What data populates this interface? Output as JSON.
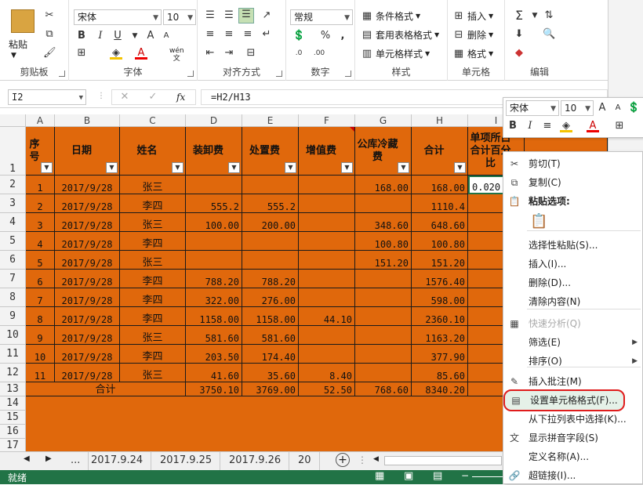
{
  "ribbon": {
    "clipboard": {
      "paste": "粘贴",
      "label": "剪贴板"
    },
    "font": {
      "name": "宋体",
      "size": "10",
      "label": "字体",
      "bold": "B",
      "italic": "I",
      "underline": "U",
      "phonetic": "wén"
    },
    "alignment": {
      "label": "对齐方式"
    },
    "number": {
      "format": "常规",
      "label": "数字",
      "percent": "%",
      "comma": ","
    },
    "styles": {
      "conditional": "条件格式",
      "table": "套用表格格式",
      "cell": "单元格样式",
      "label": "样式"
    },
    "cells": {
      "insert": "插入",
      "delete": "删除",
      "format": "格式",
      "label": "单元格"
    },
    "editing": {
      "label": "编辑"
    }
  },
  "formula_bar": {
    "name_box": "I2",
    "fx": "fx",
    "formula": "=H2/H13"
  },
  "columns": [
    "A",
    "B",
    "C",
    "D",
    "E",
    "F",
    "G",
    "H",
    "I"
  ],
  "headers": [
    "序号",
    "日期",
    "姓名",
    "装卸费",
    "处置费",
    "增值费",
    "公库冷藏费",
    "合计",
    "单项所占合计百分比"
  ],
  "row_numbers": [
    "1",
    "2",
    "3",
    "4",
    "5",
    "6",
    "7",
    "8",
    "9",
    "10",
    "11",
    "12",
    "13",
    "14",
    "15",
    "16",
    "17"
  ],
  "rows": [
    [
      "1",
      "2017/9/28",
      "张三",
      "",
      "",
      "",
      "168.00",
      "168.00",
      "0.020"
    ],
    [
      "2",
      "2017/9/28",
      "李四",
      "555.2",
      "555.2",
      "",
      "",
      "1110.4",
      ""
    ],
    [
      "3",
      "2017/9/28",
      "张三",
      "100.00",
      "200.00",
      "",
      "348.60",
      "648.60",
      ""
    ],
    [
      "4",
      "2017/9/28",
      "李四",
      "",
      "",
      "",
      "100.80",
      "100.80",
      ""
    ],
    [
      "5",
      "2017/9/28",
      "张三",
      "",
      "",
      "",
      "151.20",
      "151.20",
      ""
    ],
    [
      "6",
      "2017/9/28",
      "李四",
      "788.20",
      "788.20",
      "",
      "",
      "1576.40",
      ""
    ],
    [
      "7",
      "2017/9/28",
      "李四",
      "322.00",
      "276.00",
      "",
      "",
      "598.00",
      ""
    ],
    [
      "8",
      "2017/9/28",
      "李四",
      "1158.00",
      "1158.00",
      "44.10",
      "",
      "2360.10",
      ""
    ],
    [
      "9",
      "2017/9/28",
      "张三",
      "581.60",
      "581.60",
      "",
      "",
      "1163.20",
      ""
    ],
    [
      "10",
      "2017/9/28",
      "李四",
      "203.50",
      "174.40",
      "",
      "",
      "377.90",
      ""
    ],
    [
      "11",
      "2017/9/28",
      "张三",
      "41.60",
      "35.60",
      "8.40",
      "",
      "85.60",
      ""
    ]
  ],
  "total_row": {
    "label": "合计",
    "values": [
      "3750.10",
      "3769.00",
      "52.50",
      "768.60",
      "8340.20"
    ]
  },
  "tabs": {
    "ellipsis": "...",
    "sheets": [
      "2017.9.24",
      "2017.9.25",
      "2017.9.26",
      "20"
    ]
  },
  "status": {
    "text": "就绪"
  },
  "mini_toolbar": {
    "font": "宋体",
    "size": "10"
  },
  "context_menu": [
    {
      "label": "剪切(T)",
      "icon": "scissors-icon"
    },
    {
      "label": "复制(C)",
      "icon": "copy-icon"
    },
    {
      "label": "粘贴选项:",
      "icon": "paste-icon"
    },
    {
      "label": "",
      "icon": "paste-clipboard-icon"
    },
    {
      "label": "选择性粘贴(S)...",
      "icon": ""
    },
    {
      "label": "插入(I)...",
      "icon": ""
    },
    {
      "label": "删除(D)...",
      "icon": ""
    },
    {
      "label": "清除内容(N)",
      "icon": ""
    },
    {
      "label": "快速分析(Q)",
      "icon": "quick-analysis-icon"
    },
    {
      "label": "筛选(E)",
      "icon": ""
    },
    {
      "label": "排序(O)",
      "icon": ""
    },
    {
      "label": "插入批注(M)",
      "icon": "comment-icon"
    },
    {
      "label": "设置单元格格式(F)...",
      "icon": "format-cells-icon"
    },
    {
      "label": "从下拉列表中选择(K)...",
      "icon": ""
    },
    {
      "label": "显示拼音字段(S)",
      "icon": "phonetic-icon"
    },
    {
      "label": "定义名称(A)...",
      "icon": ""
    },
    {
      "label": "超链接(I)...",
      "icon": "hyperlink-icon"
    }
  ],
  "colors": {
    "accent": "#217346",
    "cell_fill": "#e0680c",
    "highlight": "#e01c1c"
  }
}
